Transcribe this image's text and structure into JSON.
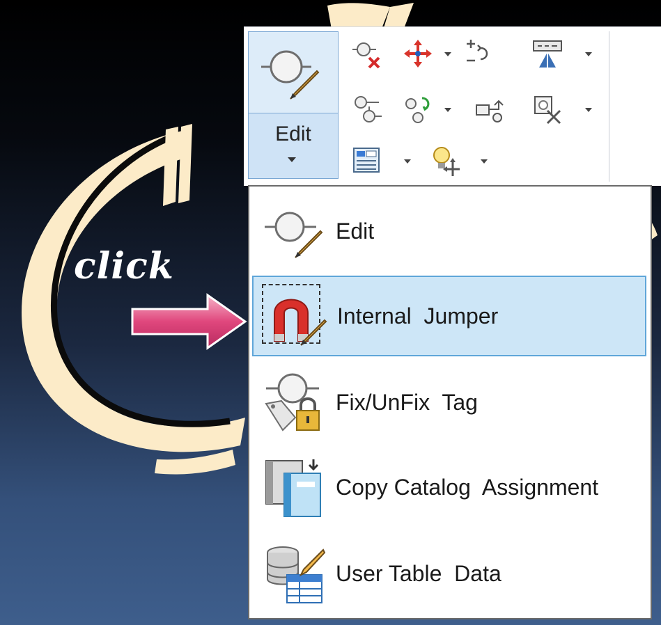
{
  "annotation": {
    "click_text": "click"
  },
  "ribbon": {
    "edit_button_label": "Edit",
    "tools": [
      {
        "icon": "delete-connector-icon"
      },
      {
        "icon": "move-icon",
        "has_dropdown": true
      },
      {
        "icon": "flip-icon"
      },
      {
        "icon": "insert-component-icon",
        "has_dropdown": true
      },
      {
        "icon": "toggle-connector-icon"
      },
      {
        "icon": "swap-icon",
        "has_dropdown": true
      },
      {
        "icon": "reroute-icon"
      },
      {
        "icon": "scale-icon",
        "has_dropdown": true
      },
      {
        "icon": "attribute-editor-icon",
        "has_dropdown": true
      },
      {
        "icon": "lamp-move-icon",
        "has_dropdown": true
      }
    ]
  },
  "menu": {
    "items": [
      {
        "label": "Edit",
        "icon": "edit-component-icon",
        "selected": false
      },
      {
        "label": "Internal  Jumper",
        "icon": "internal-jumper-icon",
        "selected": true
      },
      {
        "label": "Fix/UnFix  Tag",
        "icon": "fix-tag-icon",
        "selected": false
      },
      {
        "label": "Copy Catalog  Assignment",
        "icon": "copy-catalog-icon",
        "selected": false
      },
      {
        "label": "User Table  Data",
        "icon": "user-table-icon",
        "selected": false
      }
    ]
  },
  "colors": {
    "decor_cream": "#fcebc8",
    "arrow_pink": "#e0477d",
    "menu_highlight": "#cde6f7",
    "ribbon_button_active": "#cfe3f6"
  }
}
